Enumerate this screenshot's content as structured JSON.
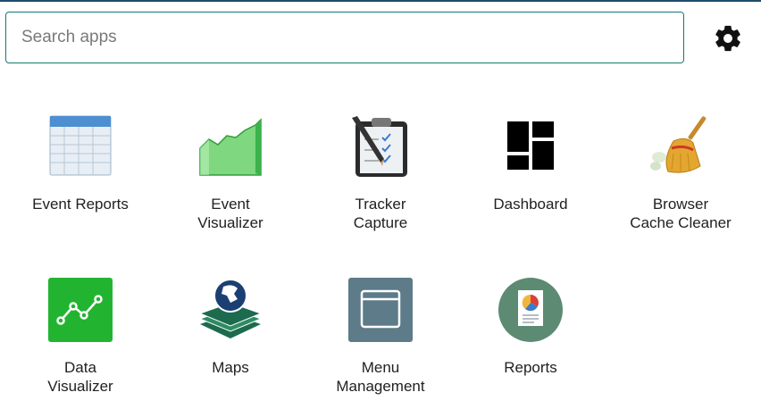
{
  "search": {
    "placeholder": "Search apps",
    "value": ""
  },
  "apps": [
    {
      "label": "Event Reports",
      "icon": "event-reports-icon"
    },
    {
      "label": "Event\nVisualizer",
      "icon": "event-visualizer-icon"
    },
    {
      "label": "Tracker\nCapture",
      "icon": "tracker-capture-icon"
    },
    {
      "label": "Dashboard",
      "icon": "dashboard-icon"
    },
    {
      "label": "Browser\nCache Cleaner",
      "icon": "broom-icon"
    },
    {
      "label": "Data\nVisualizer",
      "icon": "data-visualizer-icon"
    },
    {
      "label": "Maps",
      "icon": "maps-icon"
    },
    {
      "label": "Menu\nManagement",
      "icon": "menu-management-icon"
    },
    {
      "label": "Reports",
      "icon": "reports-icon"
    }
  ],
  "colors": {
    "accent": "#147a6f",
    "topline": "#1e4d6b",
    "data_visualizer": "#22b431",
    "menu_management": "#5d7b88"
  }
}
